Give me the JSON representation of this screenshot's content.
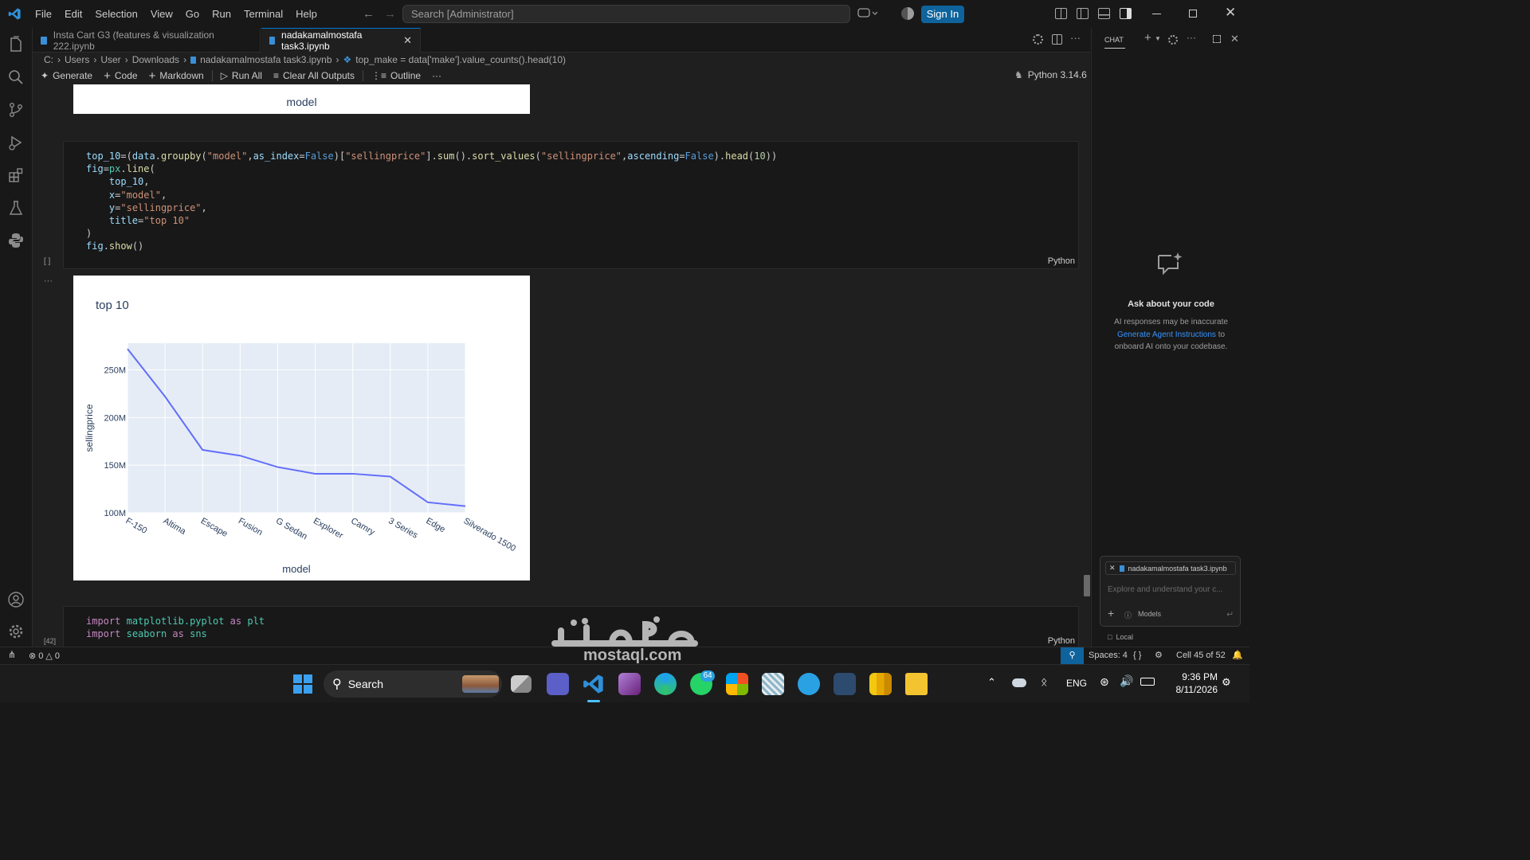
{
  "titlebar": {
    "menu": [
      "File",
      "Edit",
      "Selection",
      "View",
      "Go",
      "Run",
      "Terminal",
      "Help"
    ],
    "search_placeholder": "Search [Administrator]",
    "signin_label": "Sign In"
  },
  "tabs": [
    {
      "label": "Insta Cart G3 (features & visualization 222.ipynb",
      "active": false
    },
    {
      "label": "nadakamalmostafa task3.ipynb",
      "active": true
    }
  ],
  "breadcrumb": [
    "C:",
    "Users",
    "User",
    "Downloads",
    "nadakamalmostafa task3.ipynb",
    "top_make = data['make'].value_counts().head(10)"
  ],
  "toolbar": {
    "generate": "Generate",
    "code": "Code",
    "markdown": "Markdown",
    "run_all": "Run All",
    "clear_outputs": "Clear All Outputs",
    "outline": "Outline",
    "more": "···",
    "kernel": "Python 3.14.6"
  },
  "prev_output": {
    "xlabel": "model"
  },
  "cell1": {
    "exec_label": "[ ]",
    "lang": "Python",
    "output_more": "···"
  },
  "cell2": {
    "exec_label": "[42]",
    "lang": "Python",
    "lines": [
      "import matplotlib.pyplot as plt",
      "import seaborn as sns"
    ]
  },
  "chart_data": {
    "type": "line",
    "title": "top 10",
    "xlabel": "model",
    "ylabel": "sellingprice",
    "categories": [
      "F-150",
      "Altima",
      "Escape",
      "Fusion",
      "G Sedan",
      "Explorer",
      "Camry",
      "3 Series",
      "Edge",
      "Silverado 1500"
    ],
    "values": [
      272,
      222,
      166,
      160,
      148,
      141,
      141,
      138,
      111,
      107
    ],
    "value_unit": "M",
    "ylim": [
      100,
      278
    ],
    "yticks": [
      "100M",
      "150M",
      "200M",
      "250M"
    ],
    "ytick_values": [
      100,
      150,
      200,
      250
    ],
    "grid": true,
    "line_color": "#636efa",
    "plot_bg": "#e5ecf6"
  },
  "chat": {
    "header": "CHAT",
    "heading": "Ask about your code",
    "line1": "AI responses may be inaccurate",
    "link": "Generate Agent Instructions",
    "line2_suffix": "to",
    "line3": "onboard AI onto your codebase.",
    "context_file": "nadakamalmostafa task3.ipynb",
    "input_placeholder": "Explore and understand your c...",
    "models_label": "Models",
    "local_label": "Local"
  },
  "status": {
    "errors": "0",
    "warnings": "0",
    "spaces": "Spaces: 4",
    "braces": "{ }",
    "cell": "Cell 45 of 52"
  },
  "taskbar": {
    "search_label": "Search",
    "whatsapp_badge": "64",
    "lang": "ENG",
    "time": "9:36 PM",
    "date": "8/11/2026"
  },
  "watermark": {
    "text": "mostaql.com"
  }
}
